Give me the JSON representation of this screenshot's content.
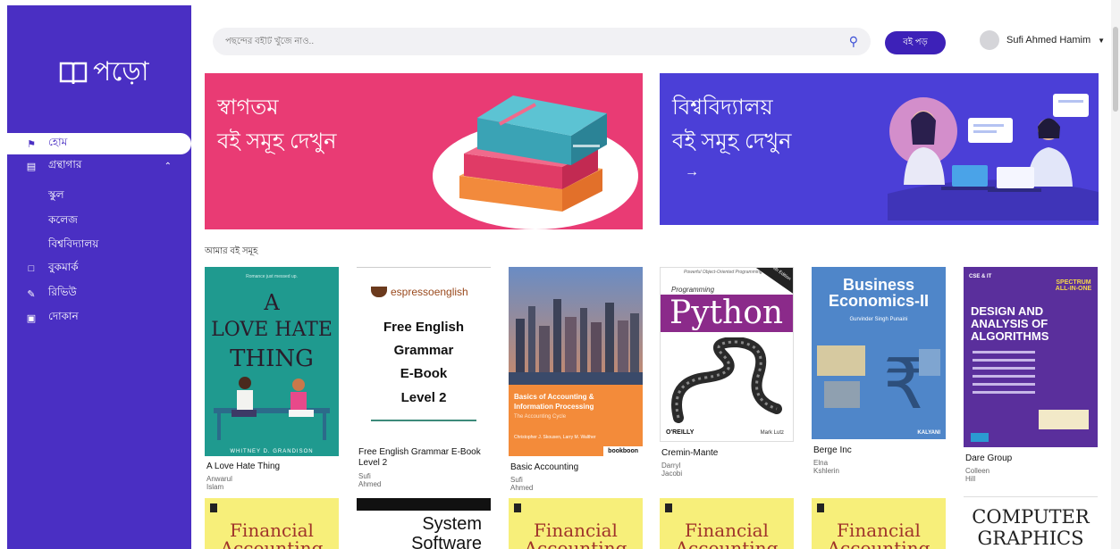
{
  "app": {
    "logo_text": "পড়ো"
  },
  "sidebar": {
    "items": [
      {
        "label": "হোম",
        "icon": "home-icon"
      },
      {
        "label": "গ্রন্থাগার",
        "icon": "library-icon"
      },
      {
        "label": "বুকমার্ক",
        "icon": "bookmark-icon"
      },
      {
        "label": "রিভিউ",
        "icon": "pencil-icon"
      },
      {
        "label": "দোকান",
        "icon": "shop-icon"
      }
    ],
    "sub_items": [
      {
        "label": "স্কুল"
      },
      {
        "label": "কলেজ"
      },
      {
        "label": "বিশ্ববিদ্যালয়"
      }
    ]
  },
  "header": {
    "search_placeholder": "পছন্দের বইটি খুঁজে নাও..",
    "read_button": "বই পড়",
    "user_name": "Sufi Ahmed Hamim"
  },
  "banners": [
    {
      "line1": "স্বাগতম",
      "line2": "বই সমূহ দেখুন",
      "color": "#e93b74"
    },
    {
      "line1": "বিশ্ববিদ্যালয়",
      "line2": "বই সমূহ দেখুন",
      "arrow": "→",
      "color": "#4b3fd7"
    }
  ],
  "section": {
    "title": "আমার বই সমূহ"
  },
  "books": [
    {
      "title": "A Love Hate Thing",
      "author": "Anwarul Islam",
      "cover_text": [
        "A",
        "LOVE HATE",
        "THING"
      ],
      "cover_author": "WHITNEY D. GRANDISON",
      "cover_top": "Romance just messed up."
    },
    {
      "title": "Free English Grammar E-Book Level 2",
      "author": "Sufi Ahmed",
      "cover_brand": "espressoenglish",
      "cover_text": [
        "Free English",
        "Grammar",
        "E-Book",
        "Level 2"
      ]
    },
    {
      "title": "Basic Accounting",
      "author": "Sufi Ahmed",
      "cover_text": [
        "Basics of Accounting &",
        "Information Processing"
      ],
      "cover_sub": "The Accounting Cycle",
      "cover_author": "Christopher J. Skousen, Larry M. Walther",
      "cover_brand": "bookboon"
    },
    {
      "title": "Cremin-Mante",
      "author": "Darryl Jacobi",
      "cover_top": "Powerful Object-Oriented Programming",
      "cover_small": "Programming",
      "cover_text": [
        "Python"
      ],
      "cover_brand": "O'REILLY",
      "cover_author": "Mark Lutz",
      "cover_corner": "4th Edition"
    },
    {
      "title": "Berge Inc",
      "author": "Elna Kshlerin",
      "cover_text": [
        "Business",
        "Economics-II"
      ],
      "cover_author": "Gurvinder Singh Punaini",
      "cover_brand": "KALYANI"
    },
    {
      "title": "Dare Group",
      "author": "Colleen Hill",
      "cover_top": "CSE & IT",
      "cover_text": [
        "DESIGN AND",
        "ANALYSIS OF",
        "ALGORITHMS"
      ],
      "cover_corner": "SPECTRUM ALL-IN-ONE"
    }
  ],
  "row2": [
    {
      "cover_text": [
        "Financial",
        "Accounting"
      ]
    },
    {
      "cover_text": [
        "System",
        "Software"
      ]
    },
    {
      "cover_text": [
        "Financial",
        "Accounting"
      ]
    },
    {
      "cover_text": [
        "Financial",
        "Accounting"
      ]
    },
    {
      "cover_text": [
        "Financial",
        "Accounting"
      ]
    },
    {
      "cover_text": [
        "COMPUTER",
        "GRAPHICS"
      ]
    }
  ]
}
